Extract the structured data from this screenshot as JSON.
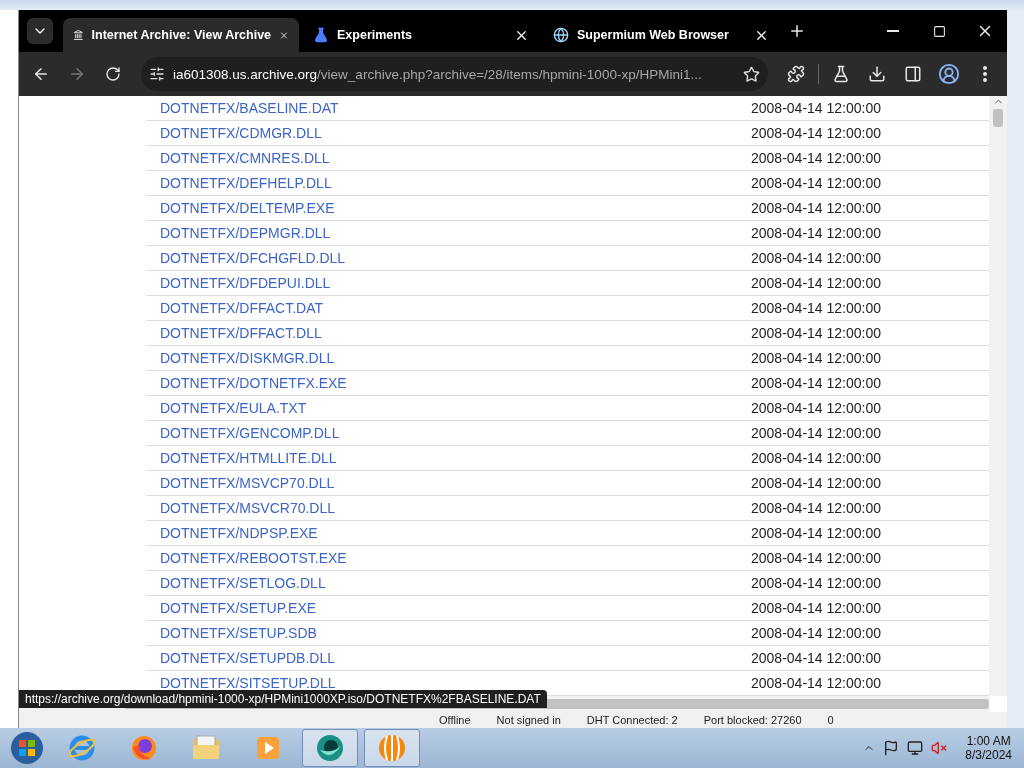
{
  "browser": {
    "tabs": [
      {
        "title": "Internet Archive: View Archive",
        "kind": "archive",
        "selected": true
      },
      {
        "title": "Experiments",
        "kind": "flask",
        "selected": false
      },
      {
        "title": "Supermium Web Browser",
        "kind": "globe",
        "selected": false
      }
    ],
    "address": {
      "host": "ia601308.us.archive.org",
      "path": "/view_archive.php?archive=/28/items/hpmini-1000-xp/HPMini1..."
    },
    "rows": [
      {
        "name": "DOTNETFX/BASELINE.DAT",
        "date": "2008-04-14 12:00:00"
      },
      {
        "name": "DOTNETFX/CDMGR.DLL",
        "date": "2008-04-14 12:00:00"
      },
      {
        "name": "DOTNETFX/CMNRES.DLL",
        "date": "2008-04-14 12:00:00"
      },
      {
        "name": "DOTNETFX/DEFHELP.DLL",
        "date": "2008-04-14 12:00:00"
      },
      {
        "name": "DOTNETFX/DELTEMP.EXE",
        "date": "2008-04-14 12:00:00"
      },
      {
        "name": "DOTNETFX/DEPMGR.DLL",
        "date": "2008-04-14 12:00:00"
      },
      {
        "name": "DOTNETFX/DFCHGFLD.DLL",
        "date": "2008-04-14 12:00:00"
      },
      {
        "name": "DOTNETFX/DFDEPUI.DLL",
        "date": "2008-04-14 12:00:00"
      },
      {
        "name": "DOTNETFX/DFFACT.DAT",
        "date": "2008-04-14 12:00:00"
      },
      {
        "name": "DOTNETFX/DFFACT.DLL",
        "date": "2008-04-14 12:00:00"
      },
      {
        "name": "DOTNETFX/DISKMGR.DLL",
        "date": "2008-04-14 12:00:00"
      },
      {
        "name": "DOTNETFX/DOTNETFX.EXE",
        "date": "2008-04-14 12:00:00"
      },
      {
        "name": "DOTNETFX/EULA.TXT",
        "date": "2008-04-14 12:00:00"
      },
      {
        "name": "DOTNETFX/GENCOMP.DLL",
        "date": "2008-04-14 12:00:00"
      },
      {
        "name": "DOTNETFX/HTMLLITE.DLL",
        "date": "2008-04-14 12:00:00"
      },
      {
        "name": "DOTNETFX/MSVCP70.DLL",
        "date": "2008-04-14 12:00:00"
      },
      {
        "name": "DOTNETFX/MSVCR70.DLL",
        "date": "2008-04-14 12:00:00"
      },
      {
        "name": "DOTNETFX/NDPSP.EXE",
        "date": "2008-04-14 12:00:00"
      },
      {
        "name": "DOTNETFX/REBOOTST.EXE",
        "date": "2008-04-14 12:00:00"
      },
      {
        "name": "DOTNETFX/SETLOG.DLL",
        "date": "2008-04-14 12:00:00"
      },
      {
        "name": "DOTNETFX/SETUP.EXE",
        "date": "2008-04-14 12:00:00"
      },
      {
        "name": "DOTNETFX/SETUP.SDB",
        "date": "2008-04-14 12:00:00"
      },
      {
        "name": "DOTNETFX/SETUPDB.DLL",
        "date": "2008-04-14 12:00:00"
      },
      {
        "name": "DOTNETFX/SITSETUP.DLL",
        "date": "2008-04-14 12:00:00"
      }
    ],
    "status_url": "https://archive.org/download/hpmini-1000-xp/HPMini1000XP.iso/DOTNETFX%2FBASELINE.DAT"
  },
  "background_status": [
    "Offline",
    "Not signed in",
    "DHT Connected: 2",
    "Port blocked: 27260",
    "0"
  ],
  "taskbar": {
    "apps": [
      {
        "kind": "ie",
        "selected": false
      },
      {
        "kind": "firefox",
        "selected": false
      },
      {
        "kind": "folder",
        "selected": false
      },
      {
        "kind": "media",
        "selected": false
      },
      {
        "kind": "teal",
        "selected": true
      },
      {
        "kind": "bitcomet",
        "selected": true
      }
    ],
    "time": "1:00 AM",
    "date": "8/3/2024"
  }
}
